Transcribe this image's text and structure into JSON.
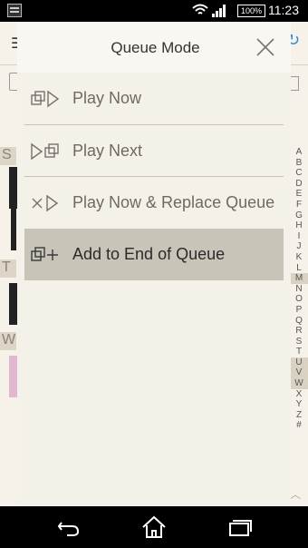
{
  "status_bar": {
    "battery": "100%",
    "time": "11:23"
  },
  "background": {
    "section_letters": [
      "S",
      "T",
      "W"
    ],
    "index_letters": [
      "A",
      "B",
      "C",
      "D",
      "E",
      "F",
      "G",
      "H",
      "I",
      "J",
      "K",
      "L",
      "M",
      "N",
      "O",
      "P",
      "Q",
      "R",
      "S",
      "T",
      "U",
      "V",
      "W",
      "X",
      "Y",
      "Z",
      "#"
    ],
    "icons": [
      "menu-icon",
      "refresh-icon"
    ]
  },
  "dialog": {
    "title": "Queue Mode",
    "close_icon": "close-icon",
    "items": [
      {
        "label": "Play Now",
        "icon": "play-now-icon",
        "selected": false
      },
      {
        "label": "Play Next",
        "icon": "play-next-icon",
        "selected": false
      },
      {
        "label": "Play Now & Replace Queue",
        "icon": "replace-queue-icon",
        "selected": false
      },
      {
        "label": "Add to End of Queue",
        "icon": "add-to-queue-icon",
        "selected": true
      }
    ]
  },
  "nav_bar": {
    "buttons": [
      "back-icon",
      "home-icon",
      "recent-apps-icon"
    ]
  },
  "colors": {
    "dialog_bg": "#f4f1e9",
    "selected_bg": "#c9c4b8",
    "divider": "#c8c1b2",
    "accent_blue": "#2a8bd6"
  }
}
